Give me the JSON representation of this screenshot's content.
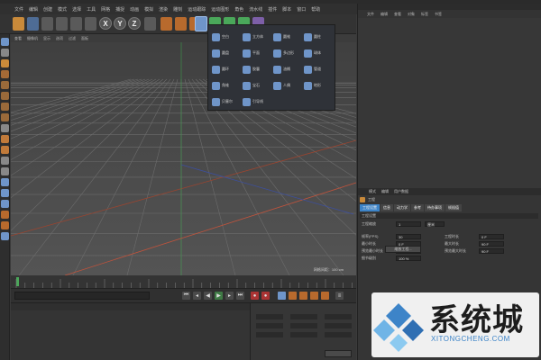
{
  "menubar": {
    "items": [
      "文件",
      "编辑",
      "创建",
      "模式",
      "选择",
      "工具",
      "网格",
      "捕捉",
      "动画",
      "模拟",
      "渲染",
      "雕刻",
      "运动跟踪",
      "运动图形",
      "角色",
      "流水线",
      "插件",
      "脚本",
      "窗口",
      "帮助"
    ]
  },
  "toolbar": {
    "axis_x": "X",
    "axis_y": "Y",
    "axis_z": "Z"
  },
  "popup": {
    "items": [
      {
        "label": "空白",
        "icon": "null-object-icon"
      },
      {
        "label": "立方体",
        "icon": "cube-icon"
      },
      {
        "label": "圆锥",
        "icon": "cone-icon"
      },
      {
        "label": "圆柱",
        "icon": "cylinder-icon"
      },
      {
        "label": "圆盘",
        "icon": "disc-icon"
      },
      {
        "label": "平面",
        "icon": "plane-icon"
      },
      {
        "label": "多边形",
        "icon": "polygon-icon"
      },
      {
        "label": "球体",
        "icon": "sphere-icon"
      },
      {
        "label": "圆环",
        "icon": "torus-icon"
      },
      {
        "label": "胶囊",
        "icon": "capsule-icon"
      },
      {
        "label": "油桶",
        "icon": "oiltank-icon"
      },
      {
        "label": "管道",
        "icon": "tube-icon"
      },
      {
        "label": "角锥",
        "icon": "pyramid-icon"
      },
      {
        "label": "宝石",
        "icon": "gem-icon"
      },
      {
        "label": "人偶",
        "icon": "figure-icon"
      },
      {
        "label": "地形",
        "icon": "landscape-icon"
      },
      {
        "label": "贝塞尔",
        "icon": "bezier-icon"
      },
      {
        "label": "引导线",
        "icon": "guide-icon"
      }
    ]
  },
  "viewport": {
    "menu": [
      "查看",
      "摄像机",
      "显示",
      "选项",
      "过滤",
      "面板"
    ],
    "status": "网格间距：100 cm"
  },
  "object_manager": {
    "menu": [
      "文件",
      "编辑",
      "查看",
      "对象",
      "标签",
      "书签"
    ]
  },
  "attribute_manager": {
    "top_tabs": [
      "模式",
      "编辑",
      "用户数据"
    ],
    "title": "工程",
    "tabs": [
      "工程设置",
      "信息",
      "动力学",
      "参考",
      "待办事项",
      "帧插值"
    ],
    "section": "工程设置",
    "rows": [
      {
        "label": "工程缩放",
        "value": "1",
        "unit": "厘米"
      },
      {
        "label": "帧率(FPS)",
        "value": "30",
        "label2": "工程时长",
        "value2": "0 F"
      },
      {
        "label": "最小时长",
        "value": "0 F",
        "label2": "最大时长",
        "value2": "90 F"
      },
      {
        "label": "预览最小时长",
        "value": "0 F",
        "label2": "预览最大时长",
        "value2": "90 F"
      },
      {
        "label": "细节级别",
        "value": "100 %"
      }
    ],
    "button": "缩放工程..."
  },
  "colors": {
    "accent_blue": "#3d84c8",
    "grid_red": "#c0533c",
    "grid_green": "#3c9a4a"
  },
  "watermark": {
    "text": "系统城",
    "sub": "XITONGCHENG.COM"
  }
}
